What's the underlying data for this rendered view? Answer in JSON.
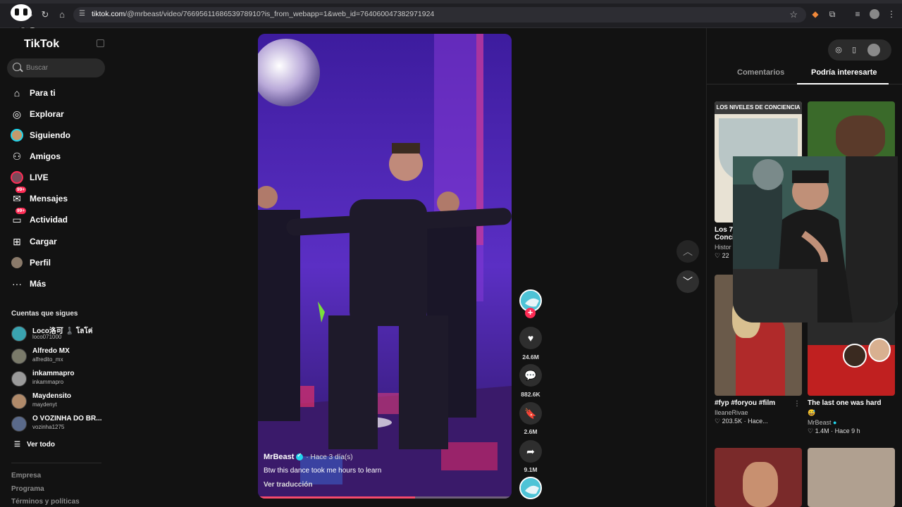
{
  "browser": {
    "url_host": "tiktok.com",
    "url_path": "/@mrbeast/video/7669561168653978910?is_from_webapp=1&web_id=7640600473829719​24"
  },
  "sidebar": {
    "logo": "TikTok",
    "search_placeholder": "Buscar",
    "nav": [
      {
        "label": "Para ti",
        "icon": "home-icon"
      },
      {
        "label": "Explorar",
        "icon": "compass-icon"
      },
      {
        "label": "Siguiendo",
        "icon": "following-avatar-icon"
      },
      {
        "label": "Amigos",
        "icon": "friends-icon"
      },
      {
        "label": "LIVE",
        "icon": "live-icon"
      },
      {
        "label": "Mensajes",
        "icon": "messages-icon",
        "badge": "99+"
      },
      {
        "label": "Actividad",
        "icon": "activity-icon",
        "badge": "99+"
      },
      {
        "label": "Cargar",
        "icon": "upload-icon"
      },
      {
        "label": "Perfil",
        "icon": "profile-icon"
      },
      {
        "label": "Más",
        "icon": "more-icon"
      }
    ],
    "following_title": "Cuentas que sigues",
    "following": [
      {
        "name": "Loco洛可 ♟️ โลโค่",
        "handle": "loco071000"
      },
      {
        "name": "Alfredo MX",
        "handle": "alfredito_mx"
      },
      {
        "name": "inkammapro",
        "handle": "inkammapro"
      },
      {
        "name": "Maydensito",
        "handle": "maydenyt"
      },
      {
        "name": "O VOZINHA DO BR...",
        "handle": "vozinha1275"
      }
    ],
    "see_all": "Ver todo",
    "footer": [
      "Empresa",
      "Programa",
      "Términos y políticas"
    ]
  },
  "video": {
    "author": "MrBeast",
    "time": "· Hace 3 día(s)",
    "caption": "Btw this dance took me hours to learn",
    "translate": "Ver traducción",
    "progress": 0.62
  },
  "actions": {
    "likes": "24.6M",
    "comments": "882.6K",
    "saves": "2.6M",
    "shares": "9.1M"
  },
  "right_panel": {
    "tabs": [
      "Comentarios",
      "Podría interesarte"
    ],
    "active_tab": 1,
    "cards": [
      {
        "thumb_text": "LOS NIVELES DE CONCIENCIA",
        "title": "Los 7",
        "title2": "Conci",
        "user": "Histor",
        "stats": "22"
      },
      {
        "title": "",
        "user": "",
        "stats": ""
      },
      {
        "title": "#fyp #foryou #film",
        "user": "IleaneRivae",
        "stats": "203.5K · Hace..."
      },
      {
        "title": "The last one was hard",
        "user": "MrBeast",
        "stats": "1.4M · Hace 9 h"
      }
    ]
  },
  "colors": {
    "accent": "#fe2c55",
    "verified": "#20d5ec",
    "background": "#121212"
  }
}
